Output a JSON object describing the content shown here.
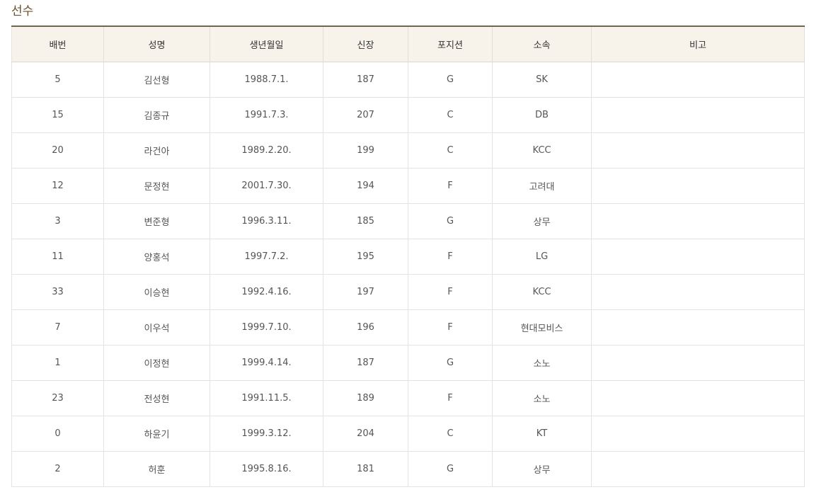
{
  "section": {
    "title": "선수"
  },
  "table": {
    "headers": [
      "배번",
      "성명",
      "생년월일",
      "신장",
      "포지션",
      "소속",
      "비고"
    ],
    "rows": [
      [
        "5",
        "김선형",
        "1988.7.1.",
        "187",
        "G",
        "SK",
        ""
      ],
      [
        "15",
        "김종규",
        "1991.7.3.",
        "207",
        "C",
        "DB",
        ""
      ],
      [
        "20",
        "라건아",
        "1989.2.20.",
        "199",
        "C",
        "KCC",
        ""
      ],
      [
        "12",
        "문정현",
        "2001.7.30.",
        "194",
        "F",
        "고려대",
        ""
      ],
      [
        "3",
        "변준형",
        "1996.3.11.",
        "185",
        "G",
        "상무",
        ""
      ],
      [
        "11",
        "양홍석",
        "1997.7.2.",
        "195",
        "F",
        "LG",
        ""
      ],
      [
        "33",
        "이승현",
        "1992.4.16.",
        "197",
        "F",
        "KCC",
        ""
      ],
      [
        "7",
        "이우석",
        "1999.7.10.",
        "196",
        "F",
        "현대모비스",
        ""
      ],
      [
        "1",
        "이정현",
        "1999.4.14.",
        "187",
        "G",
        "소노",
        ""
      ],
      [
        "23",
        "전성현",
        "1991.11.5.",
        "189",
        "F",
        "소노",
        ""
      ],
      [
        "0",
        "하윤기",
        "1999.3.12.",
        "204",
        "C",
        "KT",
        ""
      ],
      [
        "2",
        "허훈",
        "1995.8.16.",
        "181",
        "G",
        "상무",
        ""
      ]
    ]
  },
  "colors": {
    "title": "#6b4f2a",
    "header_bg": "#f7f3eb",
    "header_top_border": "#6f6556",
    "cell_border": "#e3e3e3"
  }
}
